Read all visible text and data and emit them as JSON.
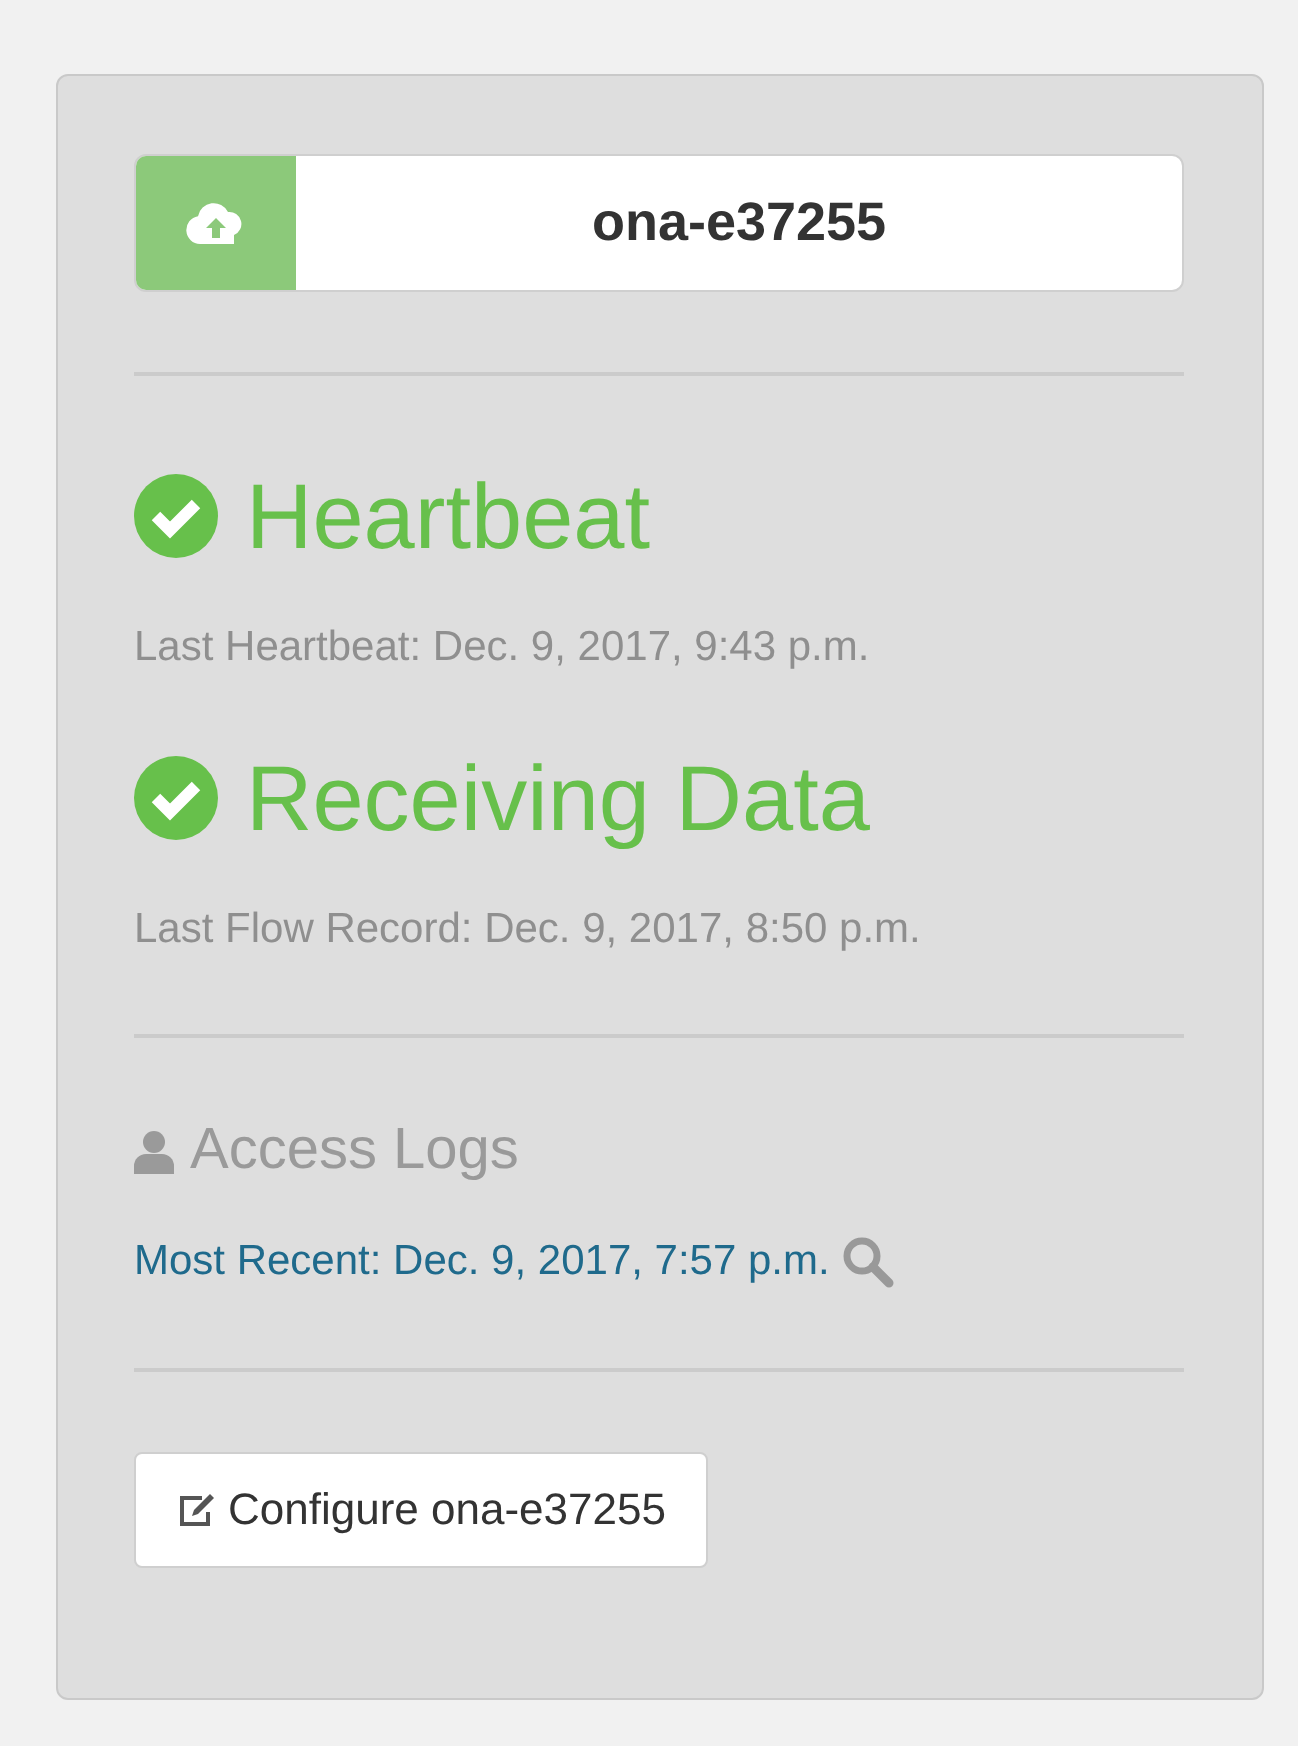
{
  "sensor": {
    "name": "ona-e37255"
  },
  "statuses": [
    {
      "title": "Heartbeat",
      "ok": true,
      "detail": "Last Heartbeat: Dec. 9, 2017, 9:43 p.m."
    },
    {
      "title": "Receiving Data",
      "ok": true,
      "detail": "Last Flow Record: Dec. 9, 2017, 8:50 p.m."
    }
  ],
  "access_logs": {
    "title": "Access Logs",
    "link": "Most Recent: Dec. 9, 2017, 7:57 p.m."
  },
  "configure_button": "Configure ona-e37255"
}
